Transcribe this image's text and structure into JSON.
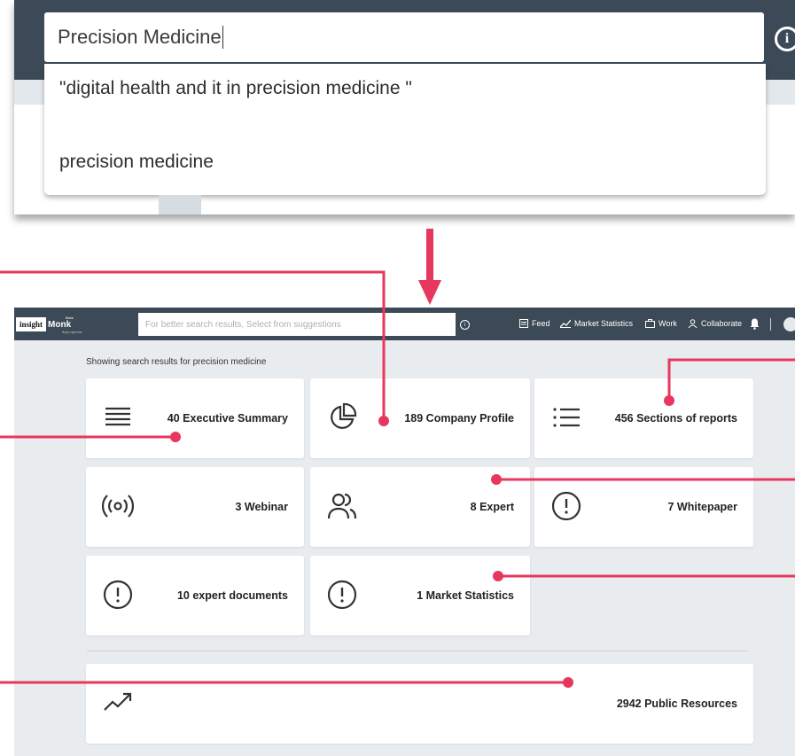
{
  "top_search": {
    "value": "Precision Medicine",
    "suggestions": [
      "\"digital health and it in precision medicine \"",
      "precision medicine"
    ]
  },
  "app": {
    "logo": {
      "insight": "insight",
      "monk": "Monk",
      "beta": "Beta",
      "tagline": "deep expertise"
    },
    "search_placeholder": "For better search results, Select from suggestions",
    "nav": {
      "feed": "Feed",
      "market_statistics": "Market Statistics",
      "work": "Work",
      "collaborate": "Collaborate"
    },
    "results_label": "Showing search results for precision medicine",
    "cards": {
      "executive_summary": "40 Executive Summary",
      "company_profile": "189 Company Profile",
      "sections_of_reports": "456 Sections of reports",
      "webinar": "3 Webinar",
      "expert": "8 Expert",
      "whitepaper": "7 Whitepaper",
      "expert_documents": "10 expert documents",
      "market_statistics": "1 Market Statistics",
      "public_resources": "2942 Public Resources"
    }
  },
  "colors": {
    "header": "#3c4a57",
    "accent_callout": "#e8375f",
    "page_bg": "#e8ecef"
  }
}
